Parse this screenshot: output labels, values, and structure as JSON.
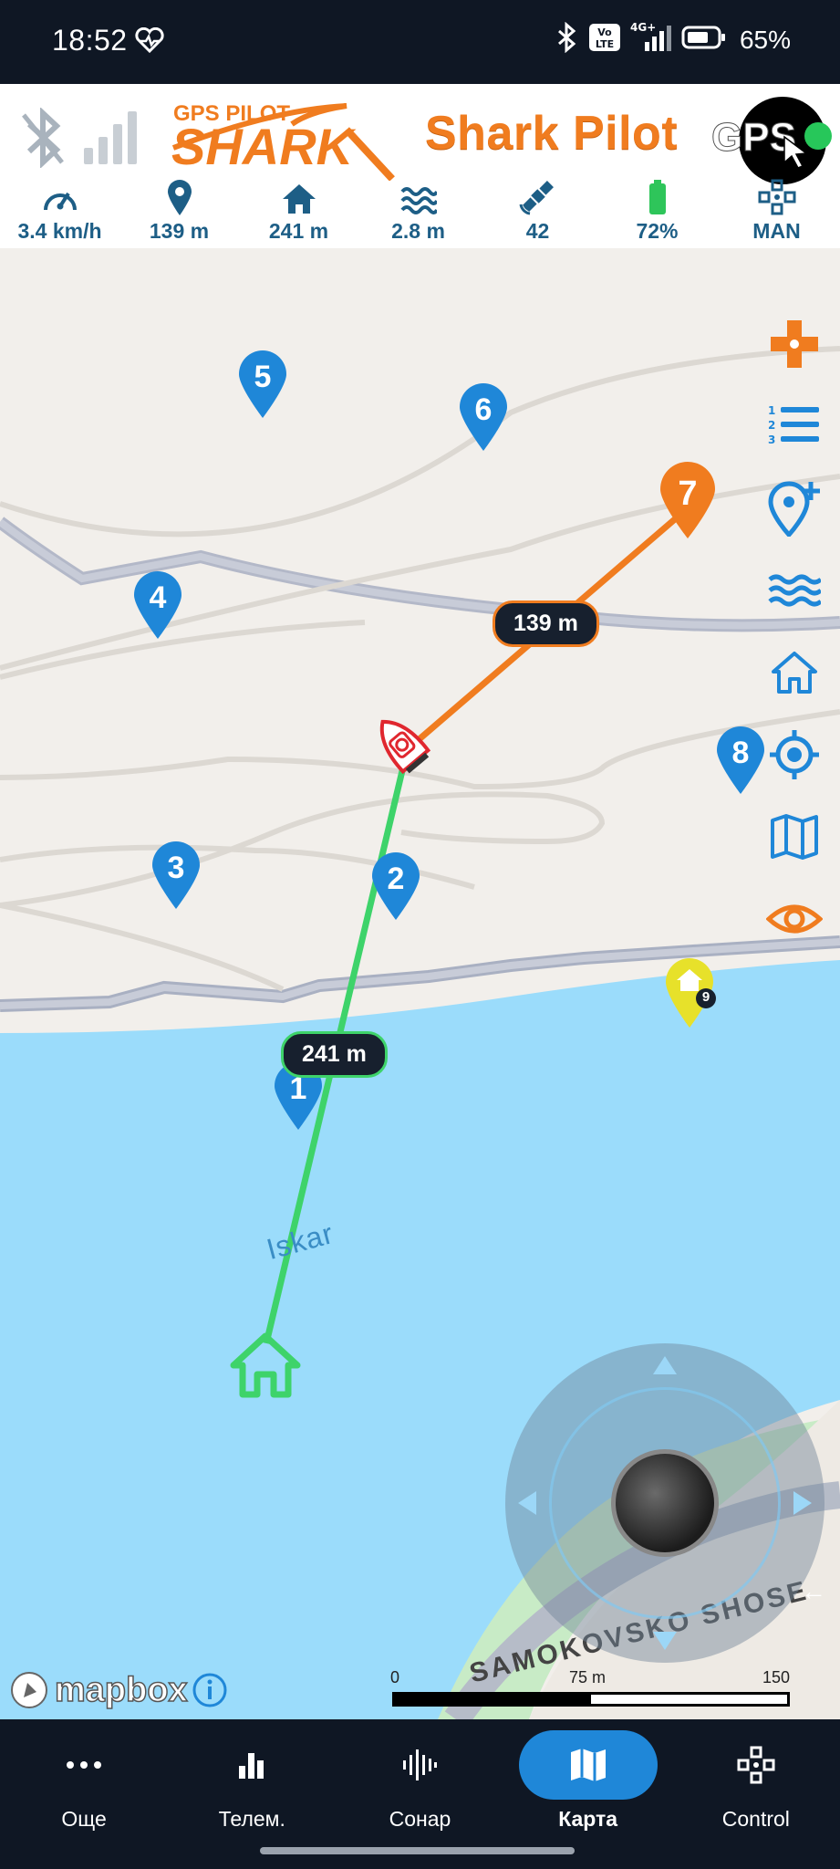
{
  "status_bar": {
    "time": "18:52",
    "battery_percent": "65%",
    "network": "4G+"
  },
  "header": {
    "logo_text_top": "GPS PILOT",
    "logo_text_main": "SHARK",
    "app_title": "Shark Pilot",
    "gps_label": "GPS",
    "gps_status_color": "#27c75a"
  },
  "stats": [
    {
      "icon": "speedometer-icon",
      "value": "3.4 km/h"
    },
    {
      "icon": "location-pin-icon",
      "value": "139 m"
    },
    {
      "icon": "home-icon",
      "value": "241 m"
    },
    {
      "icon": "waves-depth-icon",
      "value": "2.8 m"
    },
    {
      "icon": "satellite-icon",
      "value": "42"
    },
    {
      "icon": "battery-icon",
      "value": "72%"
    },
    {
      "icon": "joystick-control-icon",
      "value": "MAN"
    }
  ],
  "map": {
    "waypoints": [
      {
        "number": "1",
        "color": "#1f87d8"
      },
      {
        "number": "2",
        "color": "#1f87d8"
      },
      {
        "number": "3",
        "color": "#1f87d8"
      },
      {
        "number": "4",
        "color": "#1f87d8"
      },
      {
        "number": "5",
        "color": "#1f87d8"
      },
      {
        "number": "6",
        "color": "#1f87d8"
      },
      {
        "number": "7",
        "color": "#f07c1f"
      },
      {
        "number": "8",
        "color": "#1f87d8"
      }
    ],
    "home_marker_badge": "9",
    "distance_to_target": "139 m",
    "distance_to_home": "241 m",
    "river_name": "Iskar",
    "road_name": "SAMOKOVSKO SHOSE",
    "attribution": "mapbox",
    "scale": {
      "left": "0",
      "mid": "75 m",
      "right": "150 m"
    }
  },
  "side_tools": [
    "gamepad-icon",
    "route-list-icon",
    "add-waypoint-icon",
    "depth-waves-icon",
    "home-icon",
    "locate-target-icon",
    "map-layers-icon",
    "visibility-eye-icon"
  ],
  "bottom_nav": [
    {
      "label": "Още",
      "icon": "more-dots-icon",
      "active": false
    },
    {
      "label": "Телем.",
      "icon": "bar-chart-icon",
      "active": false
    },
    {
      "label": "Сонар",
      "icon": "sonar-wave-icon",
      "active": false
    },
    {
      "label": "Карта",
      "icon": "map-icon",
      "active": true
    },
    {
      "label": "Control",
      "icon": "joystick-control-icon",
      "active": false
    }
  ],
  "colors": {
    "accent_orange": "#f07c1f",
    "accent_blue": "#1f87d8",
    "route_green": "#3ed36a",
    "water": "#9bdcfb"
  }
}
